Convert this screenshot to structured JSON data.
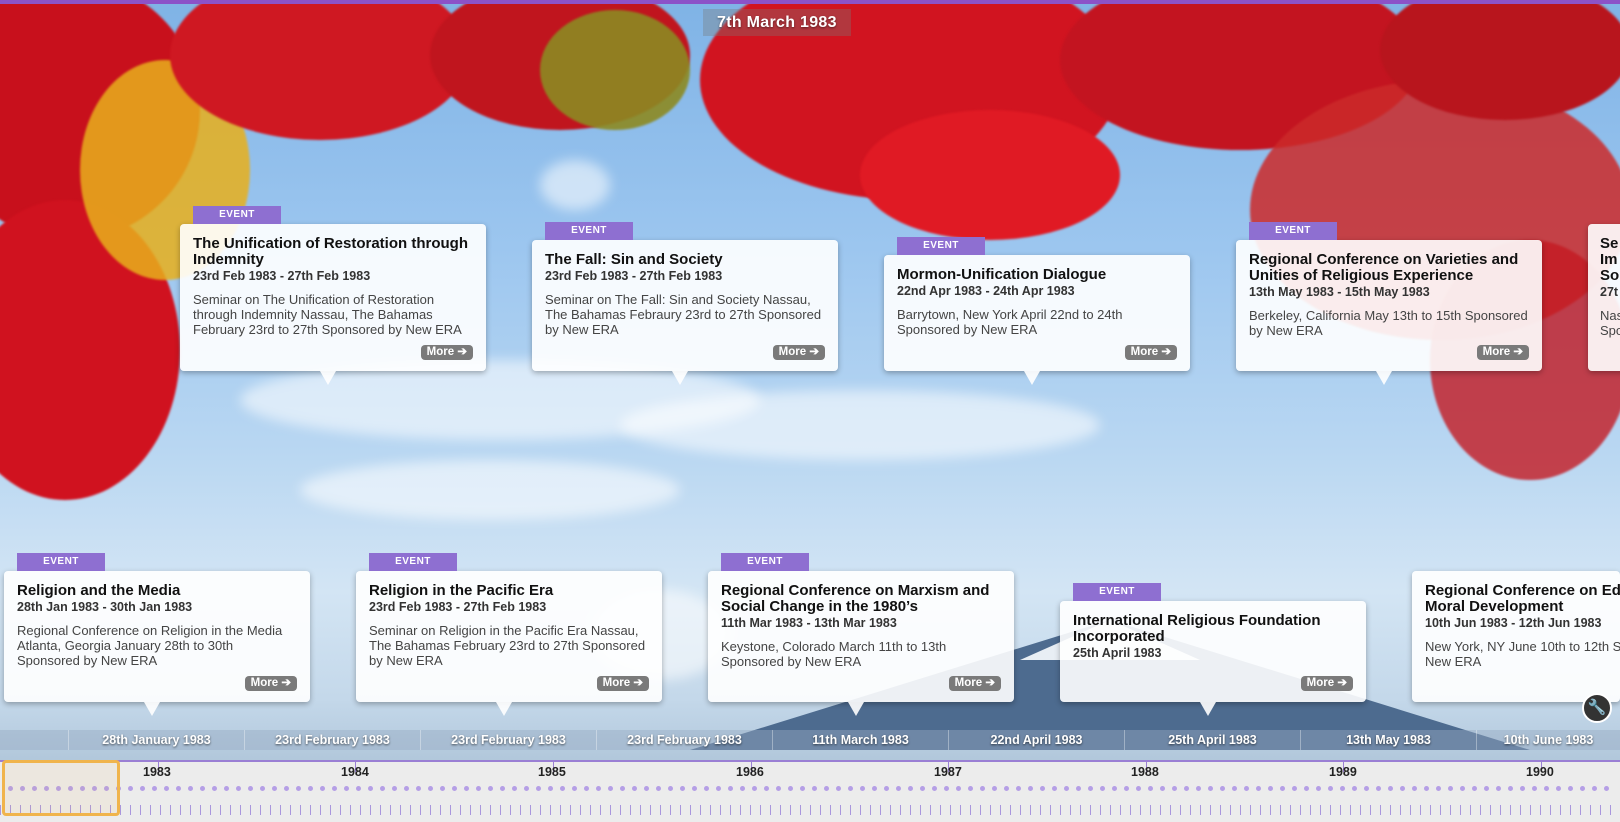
{
  "header": {
    "current_date": "7th March 1983"
  },
  "badge_label": "EVENT",
  "more_label": "More",
  "events": [
    {
      "title": "The Unification of Restoration through Indemnity",
      "date": "23rd Feb 1983 - 27th Feb 1983",
      "description": "Seminar on The Unification of Restoration through Indemnity Nassau, The Bahamas February 23rd to 27th Sponsored by New ERA"
    },
    {
      "title": "The Fall: Sin and Society",
      "date": "23rd Feb 1983 - 27th Feb 1983",
      "description": "Seminar on The Fall: Sin and Society Nassau, The Bahamas Febraury 23rd to 27th Sponsored by New ERA"
    },
    {
      "title": "Mormon-Unification Dialogue",
      "date": "22nd Apr 1983 - 24th Apr 1983",
      "description": "Barrytown, New York April 22nd to 24th Sponsored by New ERA"
    },
    {
      "title": "Regional Conference on Varieties and Unities of Religious Experience",
      "date": "13th May 1983 - 15th May 1983",
      "description": "Berkeley, California May 13th to 15th Sponsored by New ERA"
    },
    {
      "title": "Se Im So",
      "date": "27t",
      "description": "Nas Spo"
    },
    {
      "title": "Religion and the Media",
      "date": "28th Jan 1983 - 30th Jan 1983",
      "description": "Regional Conference on Religion in the Media Atlanta, Georgia January 28th to 30th Sponsored by New ERA"
    },
    {
      "title": "Religion in the Pacific Era",
      "date": "23rd Feb 1983 - 27th Feb 1983",
      "description": "Seminar on Religion in the Pacific Era Nassau, The Bahamas February 23rd to 27th Sponsored by New ERA"
    },
    {
      "title": "Regional Conference on Marxism and Social Change in the 1980’s",
      "date": "11th Mar 1983 - 13th Mar 1983",
      "description": "Keystone, Colorado March 11th to 13th Sponsored by New ERA"
    },
    {
      "title": "International Religious Foundation Incorporated",
      "date": "25th April 1983",
      "description": ""
    },
    {
      "title": "Regional Conference on Edu Moral Development",
      "date": "10th Jun 1983 - 12th Jun 1983",
      "description": "New York, NY June 10th to 12th S New ERA"
    }
  ],
  "axis_dates": [
    "28th January 1983",
    "23rd February 1983",
    "23rd February 1983",
    "23rd February 1983",
    "11th March 1983",
    "22nd April 1983",
    "25th April 1983",
    "13th May 1983",
    "10th June 1983"
  ],
  "nav_years": [
    "1983",
    "1984",
    "1985",
    "1986",
    "1987",
    "1988",
    "1989",
    "1990"
  ],
  "colors": {
    "accent": "#8c52c8",
    "badge": "#8e6fd1",
    "selector": "#f0b44c",
    "more_button": "#7a7a7a"
  },
  "icons": {
    "more": "arrow-right-icon",
    "settings": "wrench-icon"
  }
}
